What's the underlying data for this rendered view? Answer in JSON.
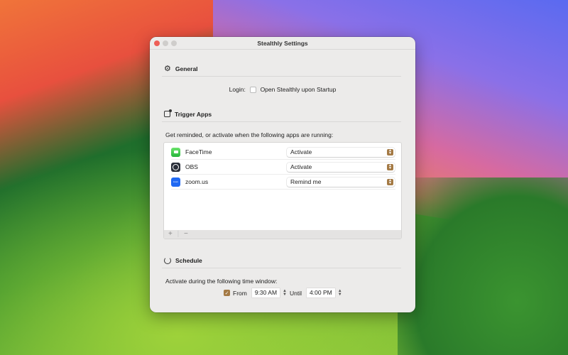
{
  "window": {
    "title": "Stealthly Settings"
  },
  "general": {
    "title": "General",
    "login_label": "Login:",
    "startup_label": "Open Stealthly upon Startup",
    "startup_checked": false
  },
  "trigger": {
    "title": "Trigger Apps",
    "description": "Get reminded, or activate when the following apps are running:",
    "apps": [
      {
        "name": "FaceTime",
        "action": "Activate",
        "icon": "facetime-icon"
      },
      {
        "name": "OBS",
        "action": "Activate",
        "icon": "obs-icon"
      },
      {
        "name": "zoom.us",
        "action": "Remind me",
        "icon": "zoom-icon",
        "icon_text": "zoom"
      }
    ],
    "add": "+",
    "remove": "−"
  },
  "schedule": {
    "title": "Schedule",
    "description": "Activate during the following time window:",
    "enabled": true,
    "from_label": "From",
    "from": "9:30 AM",
    "until_label": "Until",
    "until": "4:00 PM"
  },
  "colors": {
    "accent": "#a47a45",
    "close": "#ee5f57"
  }
}
